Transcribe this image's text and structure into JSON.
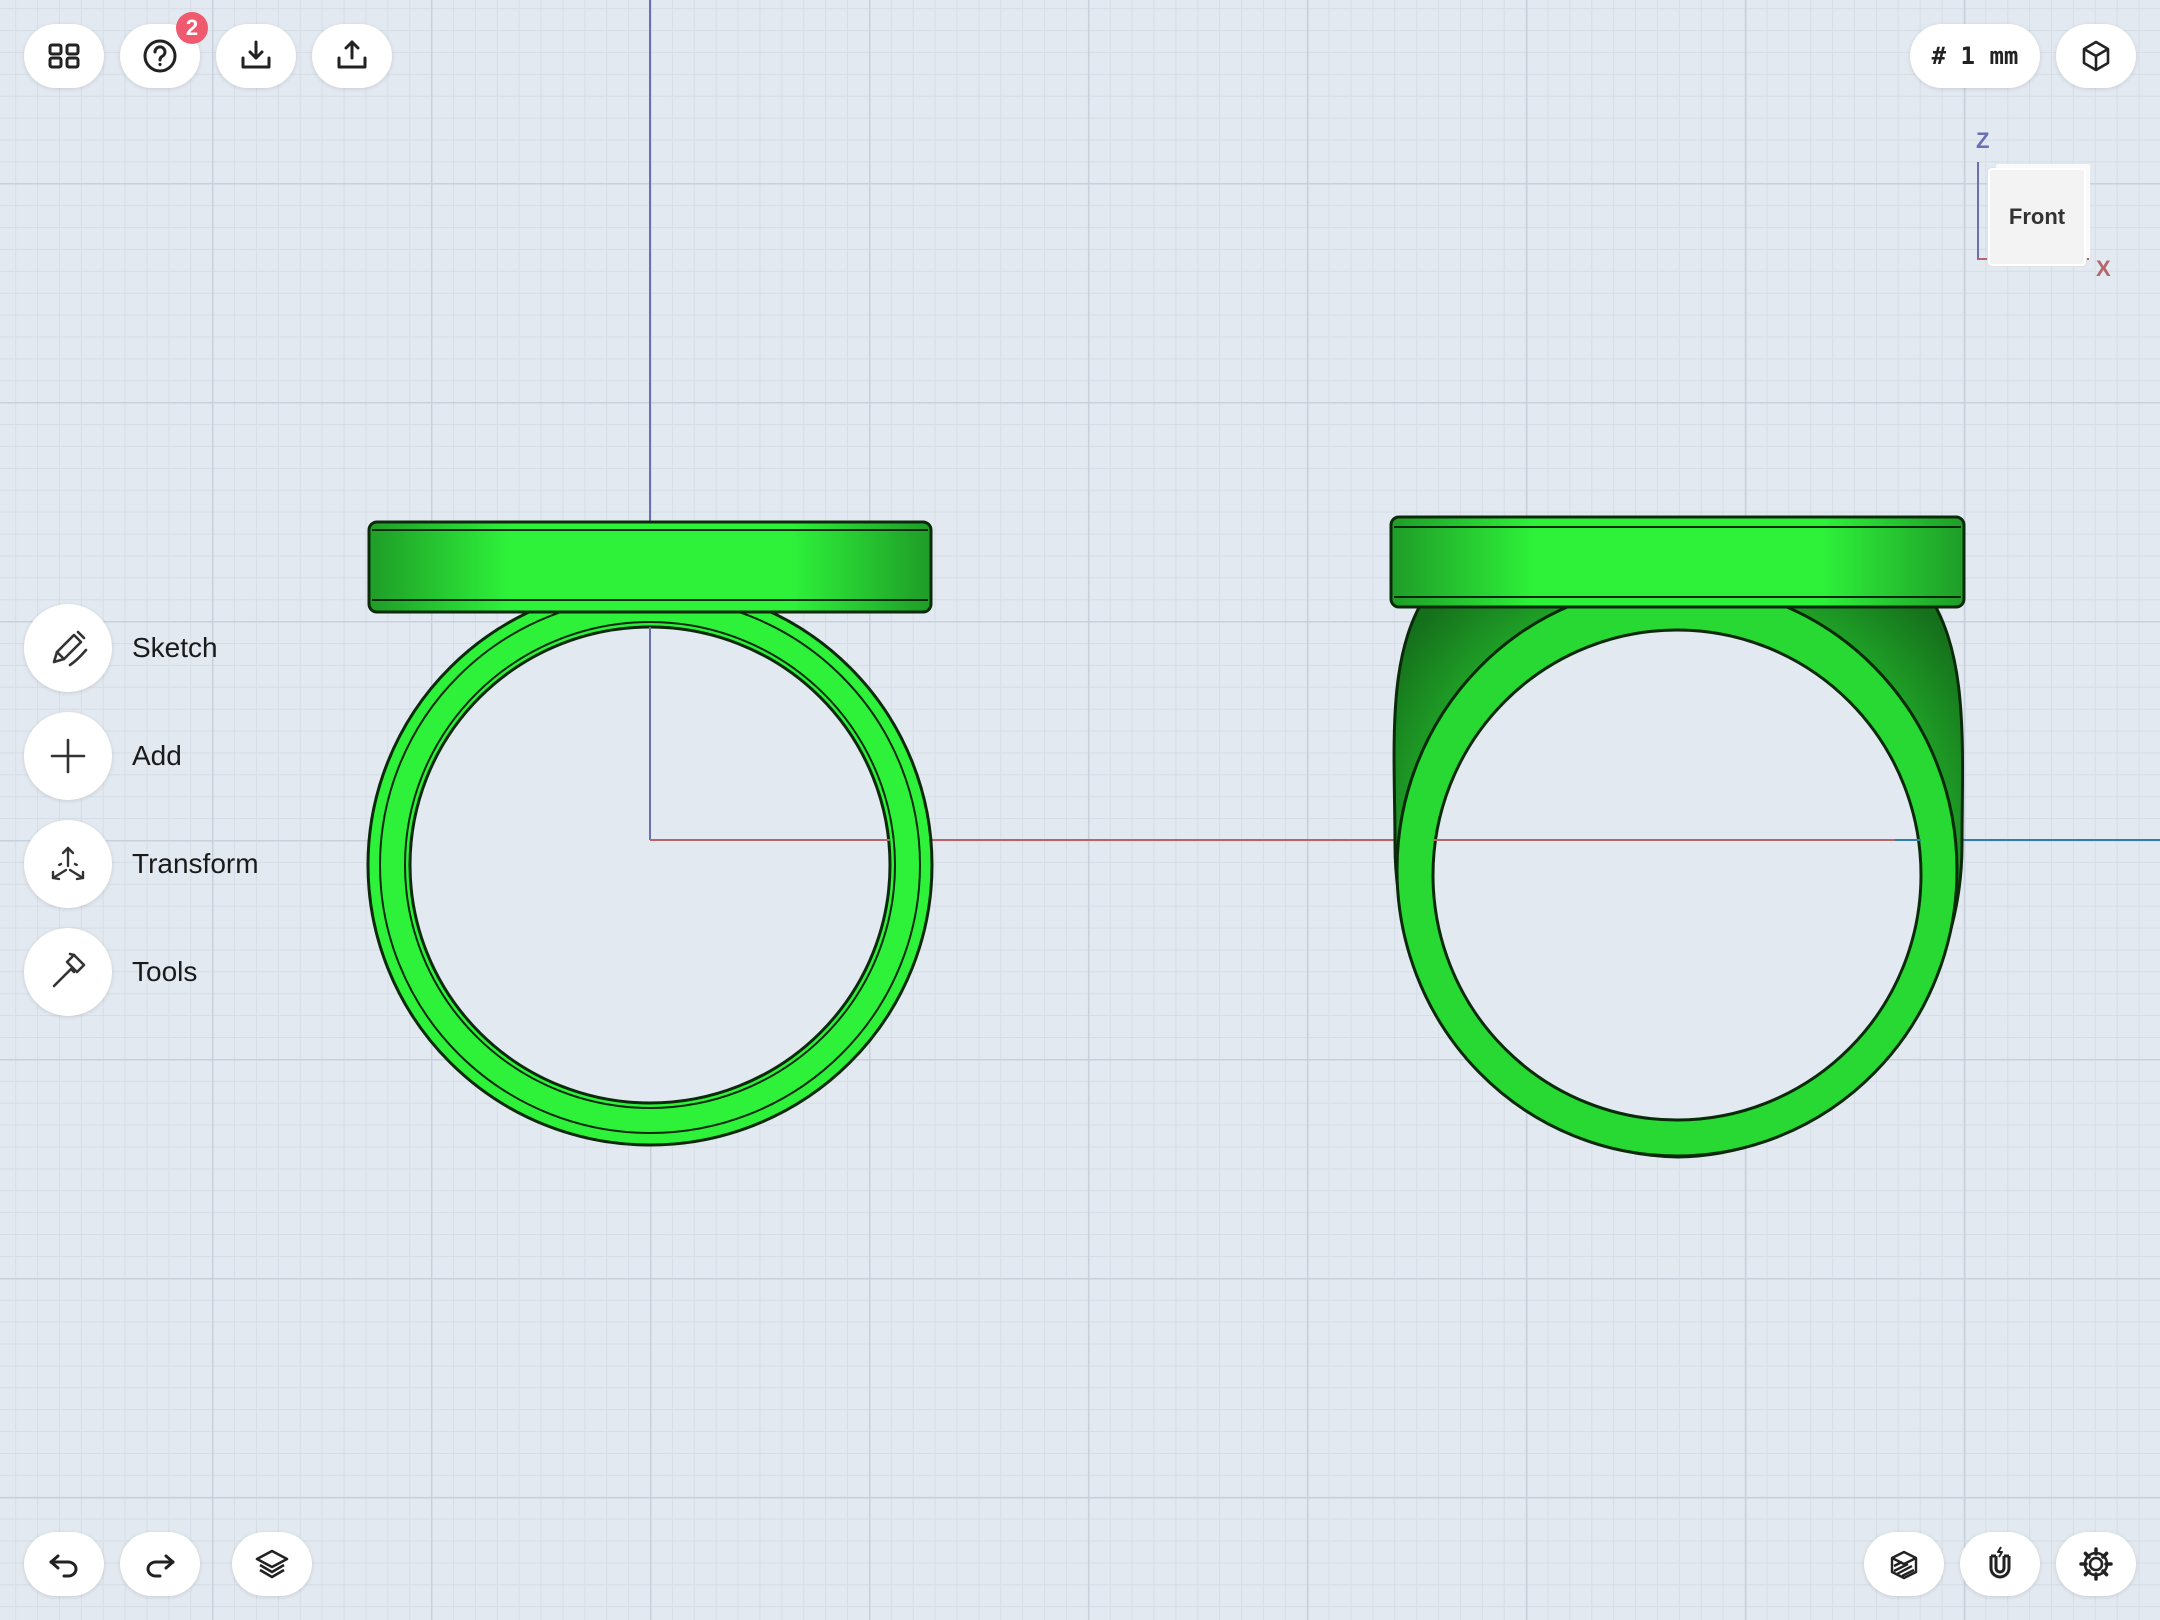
{
  "toolbar_top": {
    "help_badge": "2",
    "units_label": "# 1 mm"
  },
  "tools": [
    {
      "label": "Sketch",
      "icon": "pencil-sketch-icon"
    },
    {
      "label": "Add",
      "icon": "plus-icon"
    },
    {
      "label": "Transform",
      "icon": "transform-arrows-icon"
    },
    {
      "label": "Tools",
      "icon": "hammer-icon"
    }
  ],
  "viewcube": {
    "face_label": "Front",
    "axis_vertical": "Z",
    "axis_horizontal": "X"
  },
  "colors": {
    "background": "#e3e9f0",
    "model_green": "#2ef23a",
    "model_green_dark": "#1a8f22",
    "axis_z": "#6b6fb5",
    "axis_x": "#b5666c",
    "axis_y": "#2f7fa8",
    "badge": "#f05a6e"
  },
  "icons": {
    "grid_menu": "grid-menu-icon",
    "help": "help-icon",
    "import": "import-icon",
    "export": "export-icon",
    "view_mode": "view-mode-cube-icon",
    "undo": "undo-icon",
    "redo": "redo-icon",
    "layers": "layers-icon",
    "section_view": "section-view-icon",
    "snap": "magnet-icon",
    "settings": "gear-icon"
  }
}
